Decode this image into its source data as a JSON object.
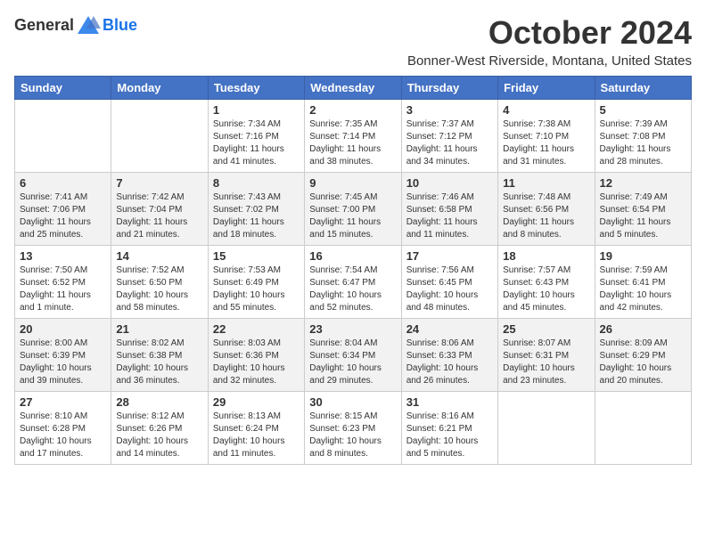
{
  "logo": {
    "general": "General",
    "blue": "Blue"
  },
  "title": "October 2024",
  "location": "Bonner-West Riverside, Montana, United States",
  "days_of_week": [
    "Sunday",
    "Monday",
    "Tuesday",
    "Wednesday",
    "Thursday",
    "Friday",
    "Saturday"
  ],
  "weeks": [
    [
      {
        "day": "",
        "info": ""
      },
      {
        "day": "",
        "info": ""
      },
      {
        "day": "1",
        "info": "Sunrise: 7:34 AM\nSunset: 7:16 PM\nDaylight: 11 hours and 41 minutes."
      },
      {
        "day": "2",
        "info": "Sunrise: 7:35 AM\nSunset: 7:14 PM\nDaylight: 11 hours and 38 minutes."
      },
      {
        "day": "3",
        "info": "Sunrise: 7:37 AM\nSunset: 7:12 PM\nDaylight: 11 hours and 34 minutes."
      },
      {
        "day": "4",
        "info": "Sunrise: 7:38 AM\nSunset: 7:10 PM\nDaylight: 11 hours and 31 minutes."
      },
      {
        "day": "5",
        "info": "Sunrise: 7:39 AM\nSunset: 7:08 PM\nDaylight: 11 hours and 28 minutes."
      }
    ],
    [
      {
        "day": "6",
        "info": "Sunrise: 7:41 AM\nSunset: 7:06 PM\nDaylight: 11 hours and 25 minutes."
      },
      {
        "day": "7",
        "info": "Sunrise: 7:42 AM\nSunset: 7:04 PM\nDaylight: 11 hours and 21 minutes."
      },
      {
        "day": "8",
        "info": "Sunrise: 7:43 AM\nSunset: 7:02 PM\nDaylight: 11 hours and 18 minutes."
      },
      {
        "day": "9",
        "info": "Sunrise: 7:45 AM\nSunset: 7:00 PM\nDaylight: 11 hours and 15 minutes."
      },
      {
        "day": "10",
        "info": "Sunrise: 7:46 AM\nSunset: 6:58 PM\nDaylight: 11 hours and 11 minutes."
      },
      {
        "day": "11",
        "info": "Sunrise: 7:48 AM\nSunset: 6:56 PM\nDaylight: 11 hours and 8 minutes."
      },
      {
        "day": "12",
        "info": "Sunrise: 7:49 AM\nSunset: 6:54 PM\nDaylight: 11 hours and 5 minutes."
      }
    ],
    [
      {
        "day": "13",
        "info": "Sunrise: 7:50 AM\nSunset: 6:52 PM\nDaylight: 11 hours and 1 minute."
      },
      {
        "day": "14",
        "info": "Sunrise: 7:52 AM\nSunset: 6:50 PM\nDaylight: 10 hours and 58 minutes."
      },
      {
        "day": "15",
        "info": "Sunrise: 7:53 AM\nSunset: 6:49 PM\nDaylight: 10 hours and 55 minutes."
      },
      {
        "day": "16",
        "info": "Sunrise: 7:54 AM\nSunset: 6:47 PM\nDaylight: 10 hours and 52 minutes."
      },
      {
        "day": "17",
        "info": "Sunrise: 7:56 AM\nSunset: 6:45 PM\nDaylight: 10 hours and 48 minutes."
      },
      {
        "day": "18",
        "info": "Sunrise: 7:57 AM\nSunset: 6:43 PM\nDaylight: 10 hours and 45 minutes."
      },
      {
        "day": "19",
        "info": "Sunrise: 7:59 AM\nSunset: 6:41 PM\nDaylight: 10 hours and 42 minutes."
      }
    ],
    [
      {
        "day": "20",
        "info": "Sunrise: 8:00 AM\nSunset: 6:39 PM\nDaylight: 10 hours and 39 minutes."
      },
      {
        "day": "21",
        "info": "Sunrise: 8:02 AM\nSunset: 6:38 PM\nDaylight: 10 hours and 36 minutes."
      },
      {
        "day": "22",
        "info": "Sunrise: 8:03 AM\nSunset: 6:36 PM\nDaylight: 10 hours and 32 minutes."
      },
      {
        "day": "23",
        "info": "Sunrise: 8:04 AM\nSunset: 6:34 PM\nDaylight: 10 hours and 29 minutes."
      },
      {
        "day": "24",
        "info": "Sunrise: 8:06 AM\nSunset: 6:33 PM\nDaylight: 10 hours and 26 minutes."
      },
      {
        "day": "25",
        "info": "Sunrise: 8:07 AM\nSunset: 6:31 PM\nDaylight: 10 hours and 23 minutes."
      },
      {
        "day": "26",
        "info": "Sunrise: 8:09 AM\nSunset: 6:29 PM\nDaylight: 10 hours and 20 minutes."
      }
    ],
    [
      {
        "day": "27",
        "info": "Sunrise: 8:10 AM\nSunset: 6:28 PM\nDaylight: 10 hours and 17 minutes."
      },
      {
        "day": "28",
        "info": "Sunrise: 8:12 AM\nSunset: 6:26 PM\nDaylight: 10 hours and 14 minutes."
      },
      {
        "day": "29",
        "info": "Sunrise: 8:13 AM\nSunset: 6:24 PM\nDaylight: 10 hours and 11 minutes."
      },
      {
        "day": "30",
        "info": "Sunrise: 8:15 AM\nSunset: 6:23 PM\nDaylight: 10 hours and 8 minutes."
      },
      {
        "day": "31",
        "info": "Sunrise: 8:16 AM\nSunset: 6:21 PM\nDaylight: 10 hours and 5 minutes."
      },
      {
        "day": "",
        "info": ""
      },
      {
        "day": "",
        "info": ""
      }
    ]
  ]
}
